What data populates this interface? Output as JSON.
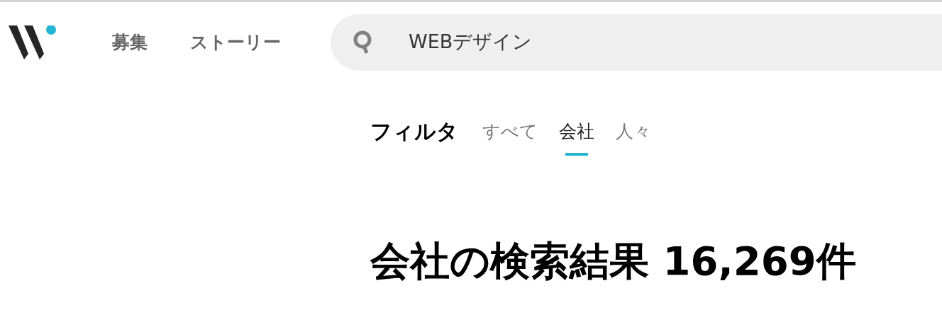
{
  "nav": [
    {
      "label": "募集"
    },
    {
      "label": "ストーリー"
    }
  ],
  "search": {
    "value": "WEBデザイン"
  },
  "filter": {
    "label": "フィルタ",
    "tabs": [
      {
        "label": "すべて",
        "selected": false
      },
      {
        "label": "会社",
        "selected": true
      },
      {
        "label": "人々",
        "selected": false
      }
    ]
  },
  "heading": "会社の検索結果 16,269件"
}
